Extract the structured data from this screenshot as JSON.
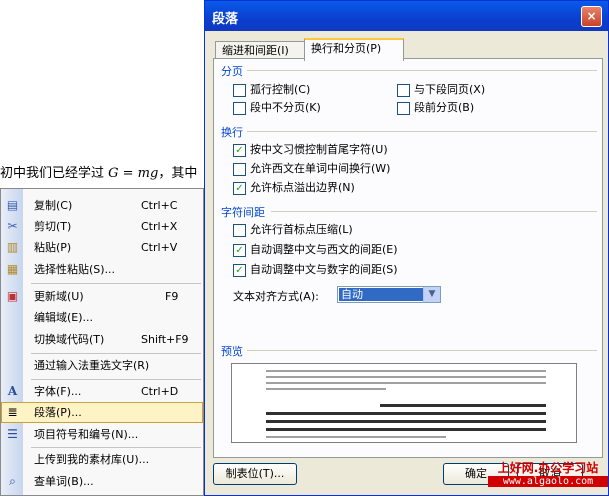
{
  "doc": {
    "text_before": "初中我们已经学过 ",
    "formula": "G = mg",
    "text_after": "，其中"
  },
  "menu": {
    "items": [
      {
        "icon": "copy-icon",
        "glyph": "▤",
        "label": "复制(C)",
        "shortcut": "Ctrl+C"
      },
      {
        "icon": "cut-icon",
        "glyph": "✂",
        "label": "剪切(T)",
        "shortcut": "Ctrl+X"
      },
      {
        "icon": "paste-icon",
        "glyph": "📋",
        "label": "粘贴(P)",
        "shortcut": "Ctrl+V"
      },
      {
        "icon": "paste-special-icon",
        "glyph": "▦",
        "label": "选择性粘贴(S)...",
        "shortcut": ""
      },
      {
        "icon": "update-field-icon",
        "glyph": "▣",
        "label": "更新域(U)",
        "shortcut": "F9"
      },
      {
        "icon": "",
        "glyph": "",
        "label": "编辑域(E)...",
        "shortcut": ""
      },
      {
        "icon": "",
        "glyph": "",
        "label": "切换域代码(T)",
        "shortcut": "Shift+F9"
      },
      {
        "icon": "",
        "glyph": "",
        "label": "通过输入法重选文字(R)",
        "shortcut": ""
      },
      {
        "icon": "font-icon",
        "glyph": "A",
        "label": "字体(F)...",
        "shortcut": "Ctrl+D"
      },
      {
        "icon": "paragraph-icon",
        "glyph": "≣",
        "label": "段落(P)...",
        "shortcut": ""
      },
      {
        "icon": "bullets-icon",
        "glyph": "☰",
        "label": "项目符号和编号(N)...",
        "shortcut": ""
      },
      {
        "icon": "",
        "glyph": "",
        "label": "上传到我的素材库(U)...",
        "shortcut": ""
      },
      {
        "icon": "lookup-icon",
        "glyph": "🔍",
        "label": "查单词(B)...",
        "shortcut": ""
      }
    ]
  },
  "dialog": {
    "title": "段落",
    "close": "×",
    "tabs": [
      "缩进和间距(I)",
      "换行和分页(P)"
    ],
    "sections": {
      "pagination": "分页",
      "line_break": "换行",
      "char_spacing": "字符间距",
      "preview": "预览"
    },
    "pagination_options": [
      {
        "label": "孤行控制(C)",
        "checked": false
      },
      {
        "label": "与下段同页(X)",
        "checked": false
      },
      {
        "label": "段中不分页(K)",
        "checked": false
      },
      {
        "label": "段前分页(B)",
        "checked": false
      }
    ],
    "linebreak_options": [
      {
        "label": "按中文习惯控制首尾字符(U)",
        "checked": true
      },
      {
        "label": "允许西文在单词中间换行(W)",
        "checked": false
      },
      {
        "label": "允许标点溢出边界(N)",
        "checked": true
      }
    ],
    "spacing_options": [
      {
        "label": "允许行首标点压缩(L)",
        "checked": false
      },
      {
        "label": "自动调整中文与西文的间距(E)",
        "checked": true
      },
      {
        "label": "自动调整中文与数字的间距(S)",
        "checked": true
      }
    ],
    "align_label": "文本对齐方式(A):",
    "align_value": "自动",
    "buttons": {
      "tabs": "制表位(T)...",
      "ok": "确定",
      "cancel": "取消"
    }
  },
  "watermark": {
    "line1": "上好网.办公学习站",
    "line2": "www.algaolo.com"
  },
  "colors": {
    "title_bar": "#0b3fd0",
    "section_text": "#0046d5",
    "highlight": "#fdf3c5",
    "select": "#316ac5"
  }
}
